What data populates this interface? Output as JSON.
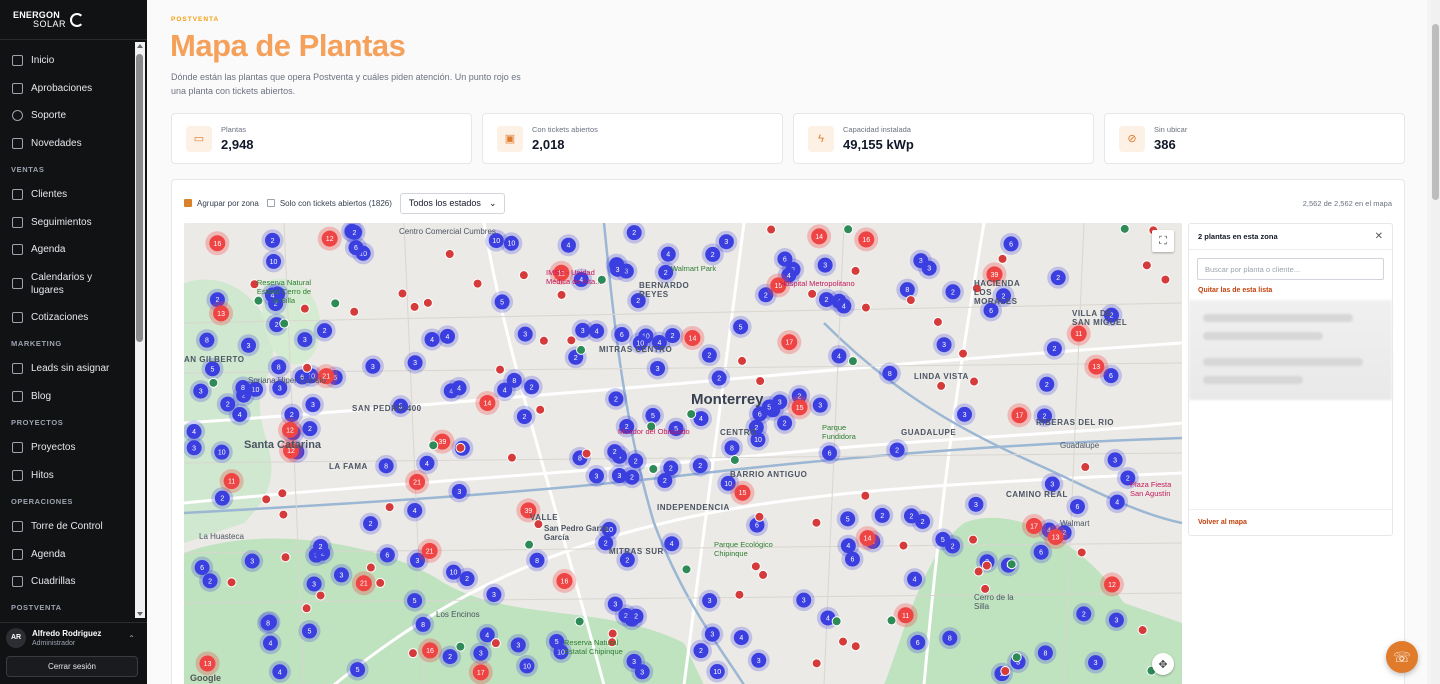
{
  "brand": {
    "line1": "ENERGON",
    "line2": "SOLAR"
  },
  "sidebar": {
    "top_items": [
      {
        "label": "Inicio",
        "icon": "home-icon"
      },
      {
        "label": "Aprobaciones",
        "icon": "clipboard-icon"
      },
      {
        "label": "Soporte",
        "icon": "lifebuoy-icon"
      },
      {
        "label": "Novedades",
        "icon": "megaphone-icon"
      }
    ],
    "sections": [
      {
        "title": "VENTAS",
        "items": [
          "Clientes",
          "Seguimientos",
          "Agenda",
          "Calendarios y lugares",
          "Cotizaciones"
        ]
      },
      {
        "title": "MARKETING",
        "items": [
          "Leads sin asignar",
          "Blog"
        ]
      },
      {
        "title": "PROYECTOS",
        "items": [
          "Proyectos",
          "Hitos"
        ]
      },
      {
        "title": "OPERACIONES",
        "items": [
          "Torre de Control",
          "Agenda",
          "Cuadrillas"
        ]
      },
      {
        "title": "POSTVENTA",
        "items": []
      }
    ],
    "user": {
      "initials": "AR",
      "name": "Alfredo Rodriguez",
      "role": "Administrador"
    },
    "logout_label": "Cerrar sesión"
  },
  "page": {
    "eyebrow": "POSTVENTA",
    "title": "Mapa de Plantas",
    "subtitle": "Dónde están las plantas que opera Postventa y cuáles piden atención. Un punto rojo es una planta con tickets abiertos."
  },
  "stats": [
    {
      "label": "Plantas",
      "value": "2,948",
      "icon": "folder-icon"
    },
    {
      "label": "Con tickets abiertos",
      "value": "2,018",
      "icon": "ticket-icon"
    },
    {
      "label": "Capacidad instalada",
      "value": "49,155 kWp",
      "icon": "bolt-icon"
    },
    {
      "label": "Sin ubicar",
      "value": "386",
      "icon": "location-off-icon"
    }
  ],
  "toolbar": {
    "group_label": "Agrupar por zona",
    "group_checked": true,
    "tickets_label": "Solo con tickets abiertos (1826)",
    "tickets_checked": false,
    "status_select": "Todos los estados",
    "count_text": "2,562 de 2,562 en el mapa"
  },
  "map": {
    "labels": {
      "city": "Monterrey",
      "d1": "SAN PEDRO 400",
      "d2": "Santa Catarina",
      "d3": "LA FAMA",
      "d4": "INDEPENDENCIA",
      "d5": "MITRAS CENTRO",
      "d6": "BERNARDO REYES",
      "d7": "CENTRO",
      "d8": "BARRIO ANTIGUO",
      "d9": "LINDA VISTA",
      "d10": "RIBERAS DEL RIO",
      "d11": "CAMINO REAL",
      "d12": "GUADALUPE",
      "d13": "VILLA DE SAN MIGUEL",
      "d14": "AN GILBERTO",
      "d15": "Guadalupe",
      "d16": "Los Encinos",
      "d17": "Cerro de la Silla",
      "d18": "La Huasteca",
      "d19": "VALLE",
      "d20": "San Pedro Garza García",
      "d21": "MITRAS SUR",
      "d22": "HACIENDA LOS MORALES",
      "p1": "IMSS - Unidad Médica de Alta...",
      "p2": "Walmart Park",
      "p3": "Hospital Metropolitano",
      "p4": "Mirador del Obispado",
      "p5": "Parque Fundidora",
      "p6": "Reserva Natural Estatal Cerro de la Silla",
      "p7": "Walmart",
      "p8": "Plaza Fiesta San Agustín",
      "p9": "Soriana Hiper Colosio",
      "p10": "Parque Ecológico Chipinque",
      "p11": "Reserva Natural Estatal Chipinque",
      "p12": "Centro Comercial Cumbres"
    },
    "google": "Google"
  },
  "side": {
    "title": "2 plantas en esta zona",
    "search_placeholder": "Buscar por planta o cliente...",
    "clear_link": "Quitar las de esta lista",
    "back_link": "Volver al mapa"
  },
  "colors": {
    "accent": "#f5a15b",
    "cluster_blue": "#3b3fe0",
    "cluster_red": "#ef4444"
  }
}
